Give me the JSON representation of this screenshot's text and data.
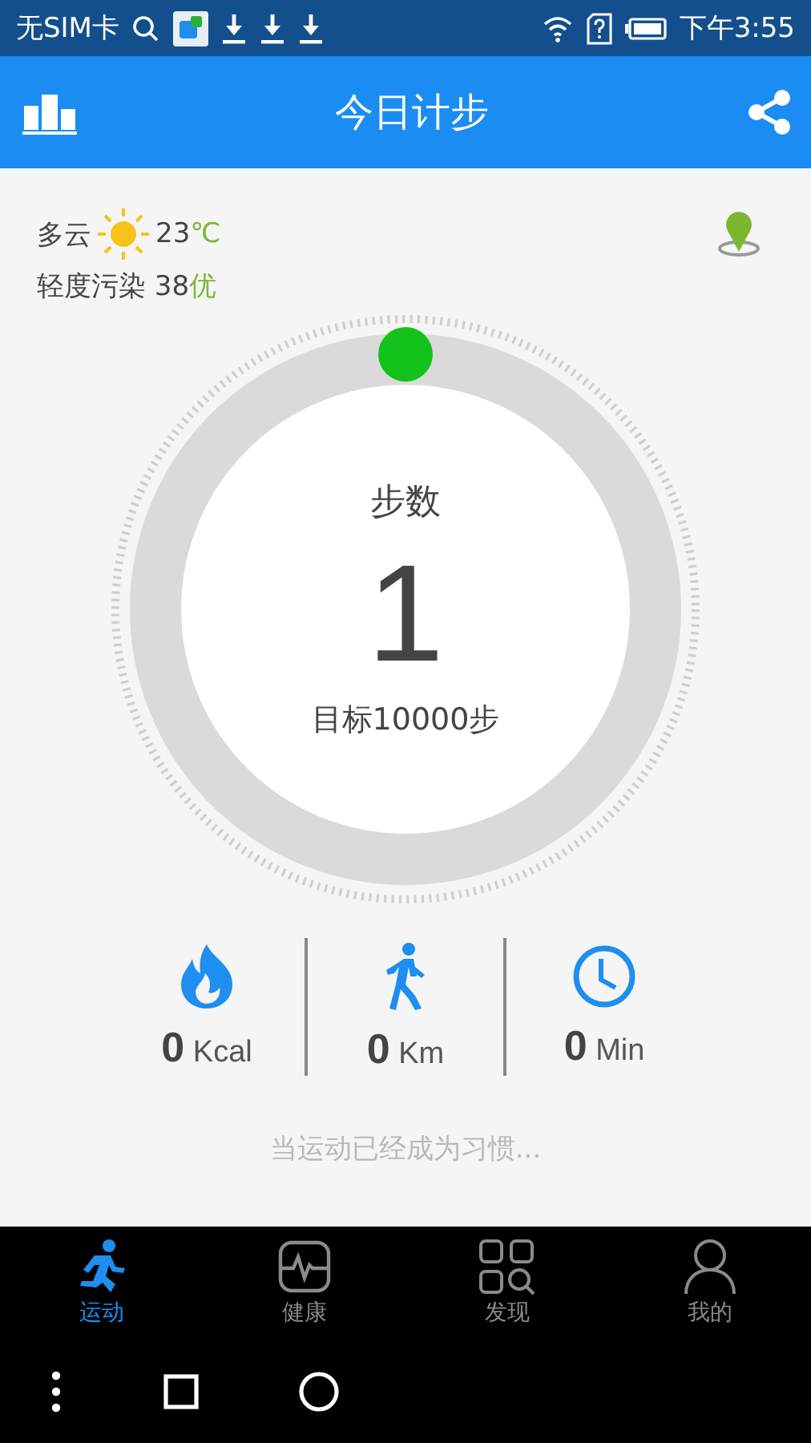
{
  "status_bar": {
    "carrier": "无SIM卡",
    "time": "下午3:55"
  },
  "app_bar": {
    "title": "今日计步"
  },
  "weather": {
    "condition": "多云",
    "temperature": "23",
    "unit": "℃",
    "pollution": "轻度污染 38",
    "quality": "优"
  },
  "ring": {
    "label": "步数",
    "steps": "1",
    "goal": "目标10000步"
  },
  "stats": [
    {
      "kind": "calories",
      "value": "0",
      "unit": "Kcal"
    },
    {
      "kind": "distance",
      "value": "0",
      "unit": "Km"
    },
    {
      "kind": "time",
      "value": "0",
      "unit": "Min"
    }
  ],
  "quote": "当运动已经成为习惯...",
  "tabs": [
    {
      "kind": "run",
      "label": "运动",
      "selected": true
    },
    {
      "kind": "health",
      "label": "健康",
      "selected": false
    },
    {
      "kind": "discover",
      "label": "发现",
      "selected": false
    },
    {
      "kind": "me",
      "label": "我的",
      "selected": false
    }
  ]
}
